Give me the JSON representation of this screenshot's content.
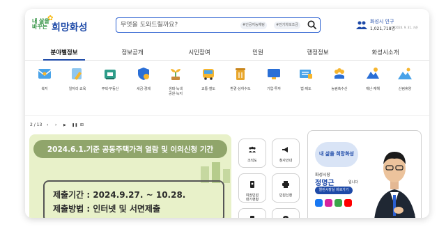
{
  "header": {
    "logo_small": "내 삶을\n바꾸는",
    "logo_big": "희망화성",
    "search_placeholder": "무엇을 도와드릴까요?",
    "search_tags": [
      "#인공지능채팅",
      "#전기차보조금"
    ],
    "population_title": "화성시 인구",
    "population_value": "1,021,718명",
    "population_date": "2024. 9. 31. 기준"
  },
  "nav": {
    "items": [
      "분야별정보",
      "정보공개",
      "시민참여",
      "민원",
      "행정정보",
      "화성시소개"
    ],
    "active_index": 0
  },
  "quick_menu": [
    {
      "label": "복지",
      "icon": "welfare-envelope-icon"
    },
    {
      "label": "일자리·교육",
      "icon": "job-pencil-icon"
    },
    {
      "label": "주택·부동산",
      "icon": "housing-icon"
    },
    {
      "label": "세금·경제",
      "icon": "tax-shield-icon"
    },
    {
      "label": "생태·녹색\n공원·녹지",
      "icon": "sprout-icon"
    },
    {
      "label": "교통·철도",
      "icon": "bus-icon"
    },
    {
      "label": "환경·상하수도",
      "icon": "trash-bin-icon"
    },
    {
      "label": "기업·투자",
      "icon": "monitor-icon"
    },
    {
      "label": "법·제도",
      "icon": "law-book-icon"
    },
    {
      "label": "농림축수산",
      "icon": "grain-icon"
    },
    {
      "label": "재난·재해",
      "icon": "disaster-icon"
    },
    {
      "label": "산림휴양",
      "icon": "mountain-icon"
    }
  ],
  "slider": {
    "counter": "2 / 13",
    "prev": "‹",
    "next": "›",
    "play": "▶",
    "pause": "❚❚",
    "grid": "⊞"
  },
  "banner": {
    "title": "2024.6.1.기준 공동주택가격 열람 및 이의신청 기간",
    "line1": "제출기간 : 2024.9.27. ~ 10.28.",
    "line2": "제출방법 : 인터넷 및 서면제출"
  },
  "services": [
    {
      "label": "조직도",
      "icon": "org-chart-icon"
    },
    {
      "label": "청사안내",
      "icon": "megaphone-icon"
    },
    {
      "label": "여권민원\n대기현황",
      "icon": "passport-icon"
    },
    {
      "label": "민원신청",
      "icon": "printer-icon"
    },
    {
      "label": "",
      "icon": "document-icon"
    },
    {
      "label": "",
      "icon": "location-pin-icon"
    }
  ],
  "mayor": {
    "logo": "내 삶을 희망화성",
    "role": "화성시장",
    "name": "정명근",
    "suffix": "입니다",
    "link": "열린시장실 바로가기"
  },
  "colors": {
    "brand": "#1e4aa8",
    "banner_bg": "#e8f1c9",
    "banner_title_bg": "#90a56b"
  }
}
